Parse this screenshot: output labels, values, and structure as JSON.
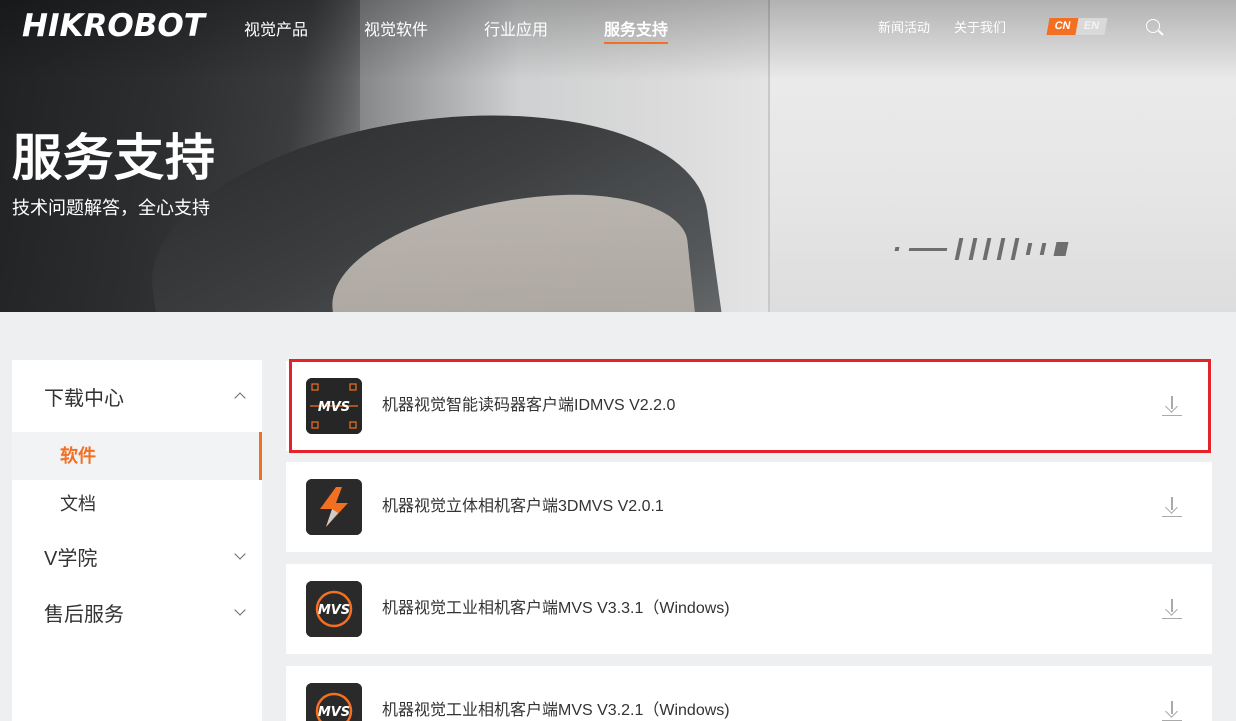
{
  "header": {
    "logo": "HIKROBOT",
    "nav": [
      "视觉产品",
      "视觉软件",
      "行业应用",
      "服务支持"
    ],
    "nav_active_index": 3,
    "right_links": [
      "新闻活动",
      "关于我们"
    ],
    "lang_cn": "CN",
    "lang_en": "EN"
  },
  "hero": {
    "title": "服务支持",
    "subtitle": "技术问题解答，全心支持"
  },
  "sidebar": {
    "groups": [
      {
        "label": "下载中心",
        "expanded": true,
        "children": [
          "软件",
          "文档"
        ],
        "active_child": "软件"
      },
      {
        "label": "V学院",
        "expanded": false
      },
      {
        "label": "售后服务",
        "expanded": false
      }
    ]
  },
  "downloads": [
    {
      "name": "机器视觉智能读码器客户端IDMVS V2.2.0",
      "icon": "idmvs-icon",
      "highlighted": true
    },
    {
      "name": "机器视觉立体相机客户端3DMVS V2.0.1",
      "icon": "3dmvs-icon"
    },
    {
      "name": "机器视觉工业相机客户端MVS V3.3.1（Windows)",
      "icon": "mvs-icon"
    },
    {
      "name": "机器视觉工业相机客户端MVS V3.2.1（Windows)",
      "icon": "mvs-icon"
    }
  ],
  "colors": {
    "accent": "#f36f21",
    "highlight": "#e5212a"
  }
}
